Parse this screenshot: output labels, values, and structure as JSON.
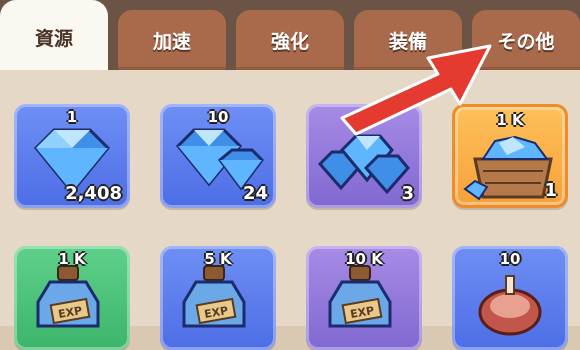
{
  "tabs": [
    {
      "label": "資源",
      "active": true
    },
    {
      "label": "加速",
      "active": false
    },
    {
      "label": "強化",
      "active": false
    },
    {
      "label": "装備",
      "active": false
    },
    {
      "label": "その他",
      "active": false
    }
  ],
  "items_row1": [
    {
      "top": "1",
      "count": "2,408",
      "icon": "single-gem-icon",
      "frame": "blue"
    },
    {
      "top": "10",
      "count": "24",
      "icon": "gem-pair-icon",
      "frame": "blue"
    },
    {
      "top": "1",
      "count": "3",
      "icon": "gem-pile-icon",
      "frame": "purple"
    },
    {
      "top": "1 K",
      "count": "1",
      "icon": "gem-crate-icon",
      "frame": "orange"
    }
  ],
  "items_row2": [
    {
      "top": "1 K",
      "count": "",
      "icon": "exp-potion-icon",
      "frame": "green"
    },
    {
      "top": "5 K",
      "count": "",
      "icon": "exp-potion-icon",
      "frame": "blue"
    },
    {
      "top": "10 K",
      "count": "",
      "icon": "exp-potion-icon",
      "frame": "purple"
    },
    {
      "top": "10",
      "count": "",
      "icon": "meat-icon",
      "frame": "blue"
    }
  ],
  "potion_label": "EXP",
  "annotation": {
    "icon": "red-arrow-icon",
    "color": "#e53a2f"
  }
}
